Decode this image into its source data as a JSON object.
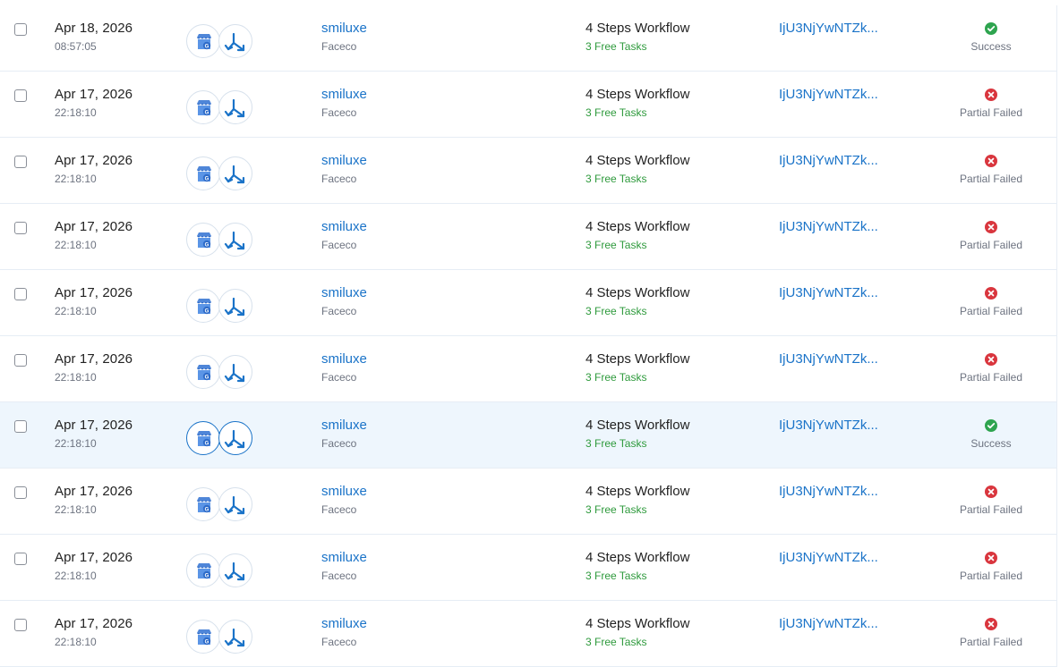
{
  "colors": {
    "link": "#1a73c8",
    "tasks_green": "#2e9a3c",
    "success_green": "#2ea44f",
    "failed_red": "#d9363e",
    "highlight_row": "#eef6fd"
  },
  "icons": [
    "google-my-business-icon",
    "split-arrows-icon"
  ],
  "rows": [
    {
      "date": "Apr 18, 2026",
      "time": "08:57:05",
      "name": "smiluxe",
      "sub": "Faceco",
      "workflow": "4 Steps Workflow",
      "tasks": "3 Free Tasks",
      "id": "IjU3NjYwNTZk...",
      "status": "Success",
      "ok": true,
      "highlighted": false
    },
    {
      "date": "Apr 17, 2026",
      "time": "22:18:10",
      "name": "smiluxe",
      "sub": "Faceco",
      "workflow": "4 Steps Workflow",
      "tasks": "3 Free Tasks",
      "id": "IjU3NjYwNTZk...",
      "status": "Partial Failed",
      "ok": false,
      "highlighted": false
    },
    {
      "date": "Apr 17, 2026",
      "time": "22:18:10",
      "name": "smiluxe",
      "sub": "Faceco",
      "workflow": "4 Steps Workflow",
      "tasks": "3 Free Tasks",
      "id": "IjU3NjYwNTZk...",
      "status": "Partial Failed",
      "ok": false,
      "highlighted": false
    },
    {
      "date": "Apr 17, 2026",
      "time": "22:18:10",
      "name": "smiluxe",
      "sub": "Faceco",
      "workflow": "4 Steps Workflow",
      "tasks": "3 Free Tasks",
      "id": "IjU3NjYwNTZk...",
      "status": "Partial Failed",
      "ok": false,
      "highlighted": false
    },
    {
      "date": "Apr 17, 2026",
      "time": "22:18:10",
      "name": "smiluxe",
      "sub": "Faceco",
      "workflow": "4 Steps Workflow",
      "tasks": "3 Free Tasks",
      "id": "IjU3NjYwNTZk...",
      "status": "Partial Failed",
      "ok": false,
      "highlighted": false
    },
    {
      "date": "Apr 17, 2026",
      "time": "22:18:10",
      "name": "smiluxe",
      "sub": "Faceco",
      "workflow": "4 Steps Workflow",
      "tasks": "3 Free Tasks",
      "id": "IjU3NjYwNTZk...",
      "status": "Partial Failed",
      "ok": false,
      "highlighted": false
    },
    {
      "date": "Apr 17, 2026",
      "time": "22:18:10",
      "name": "smiluxe",
      "sub": "Faceco",
      "workflow": "4 Steps Workflow",
      "tasks": "3 Free Tasks",
      "id": "IjU3NjYwNTZk...",
      "status": "Success",
      "ok": true,
      "highlighted": true
    },
    {
      "date": "Apr 17, 2026",
      "time": "22:18:10",
      "name": "smiluxe",
      "sub": "Faceco",
      "workflow": "4 Steps Workflow",
      "tasks": "3 Free Tasks",
      "id": "IjU3NjYwNTZk...",
      "status": "Partial Failed",
      "ok": false,
      "highlighted": false
    },
    {
      "date": "Apr 17, 2026",
      "time": "22:18:10",
      "name": "smiluxe",
      "sub": "Faceco",
      "workflow": "4 Steps Workflow",
      "tasks": "3 Free Tasks",
      "id": "IjU3NjYwNTZk...",
      "status": "Partial Failed",
      "ok": false,
      "highlighted": false
    },
    {
      "date": "Apr 17, 2026",
      "time": "22:18:10",
      "name": "smiluxe",
      "sub": "Faceco",
      "workflow": "4 Steps Workflow",
      "tasks": "3 Free Tasks",
      "id": "IjU3NjYwNTZk...",
      "status": "Partial Failed",
      "ok": false,
      "highlighted": false
    }
  ]
}
